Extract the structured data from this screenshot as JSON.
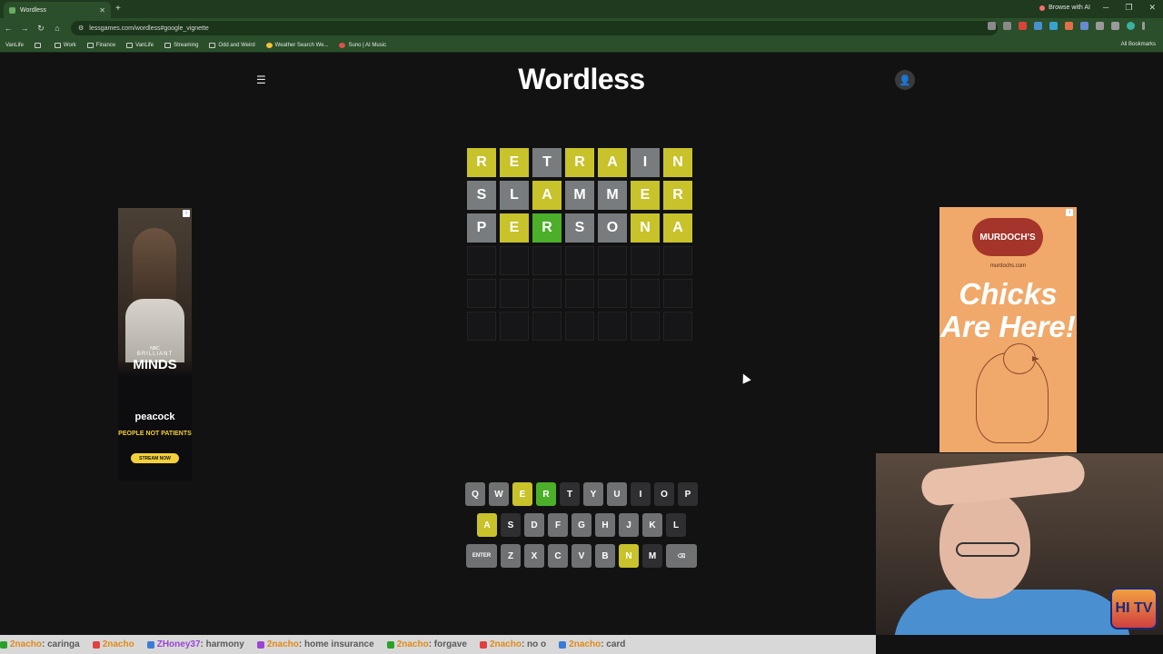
{
  "browser": {
    "tab_title": "Wordless",
    "new_tab": "+",
    "browse_ai": "Browse with AI",
    "url": "lessgames.com/wordless#google_vignette",
    "bookmarks": [
      "VanLife",
      "Work",
      "Finance",
      "VanLife",
      "Streaming",
      "Odd and Weird",
      "Weather Search We...",
      "Suno | AI Music"
    ],
    "all_bookmarks": "All Bookmarks"
  },
  "game": {
    "title": "Wordless",
    "rows": [
      [
        {
          "l": "R",
          "s": "y"
        },
        {
          "l": "E",
          "s": "y"
        },
        {
          "l": "T",
          "s": "x"
        },
        {
          "l": "R",
          "s": "y"
        },
        {
          "l": "A",
          "s": "y"
        },
        {
          "l": "I",
          "s": "x"
        },
        {
          "l": "N",
          "s": "y"
        }
      ],
      [
        {
          "l": "S",
          "s": "x"
        },
        {
          "l": "L",
          "s": "x"
        },
        {
          "l": "A",
          "s": "y"
        },
        {
          "l": "M",
          "s": "x"
        },
        {
          "l": "M",
          "s": "x"
        },
        {
          "l": "E",
          "s": "y"
        },
        {
          "l": "R",
          "s": "y"
        }
      ],
      [
        {
          "l": "P",
          "s": "x"
        },
        {
          "l": "E",
          "s": "y"
        },
        {
          "l": "R",
          "s": "g"
        },
        {
          "l": "S",
          "s": "x"
        },
        {
          "l": "O",
          "s": "x"
        },
        {
          "l": "N",
          "s": "y"
        },
        {
          "l": "A",
          "s": "y"
        }
      ],
      [
        {
          "l": "",
          "s": "e"
        },
        {
          "l": "",
          "s": "e"
        },
        {
          "l": "",
          "s": "e"
        },
        {
          "l": "",
          "s": "e"
        },
        {
          "l": "",
          "s": "e"
        },
        {
          "l": "",
          "s": "e"
        },
        {
          "l": "",
          "s": "e"
        }
      ],
      [
        {
          "l": "",
          "s": "e"
        },
        {
          "l": "",
          "s": "e"
        },
        {
          "l": "",
          "s": "e"
        },
        {
          "l": "",
          "s": "e"
        },
        {
          "l": "",
          "s": "e"
        },
        {
          "l": "",
          "s": "e"
        },
        {
          "l": "",
          "s": "e"
        }
      ],
      [
        {
          "l": "",
          "s": "e"
        },
        {
          "l": "",
          "s": "e"
        },
        {
          "l": "",
          "s": "e"
        },
        {
          "l": "",
          "s": "e"
        },
        {
          "l": "",
          "s": "e"
        },
        {
          "l": "",
          "s": "e"
        },
        {
          "l": "",
          "s": "e"
        }
      ]
    ],
    "keyboard": [
      [
        {
          "k": "Q",
          "s": ""
        },
        {
          "k": "W",
          "s": ""
        },
        {
          "k": "E",
          "s": "y"
        },
        {
          "k": "R",
          "s": "g"
        },
        {
          "k": "T",
          "s": "dark"
        },
        {
          "k": "Y",
          "s": ""
        },
        {
          "k": "U",
          "s": ""
        },
        {
          "k": "I",
          "s": "dark"
        },
        {
          "k": "O",
          "s": "dark"
        },
        {
          "k": "P",
          "s": "dark"
        }
      ],
      [
        {
          "k": "A",
          "s": "y"
        },
        {
          "k": "S",
          "s": "dark"
        },
        {
          "k": "D",
          "s": ""
        },
        {
          "k": "F",
          "s": ""
        },
        {
          "k": "G",
          "s": ""
        },
        {
          "k": "H",
          "s": ""
        },
        {
          "k": "J",
          "s": ""
        },
        {
          "k": "K",
          "s": ""
        },
        {
          "k": "L",
          "s": "dark"
        }
      ],
      [
        {
          "k": "ENTER",
          "s": "wide"
        },
        {
          "k": "Z",
          "s": ""
        },
        {
          "k": "X",
          "s": ""
        },
        {
          "k": "C",
          "s": ""
        },
        {
          "k": "V",
          "s": ""
        },
        {
          "k": "B",
          "s": ""
        },
        {
          "k": "N",
          "s": "y"
        },
        {
          "k": "M",
          "s": "dark"
        },
        {
          "k": "⌫",
          "s": "wide"
        }
      ]
    ],
    "colors": {
      "yellow": "#c8c22b",
      "green": "#4caf2a",
      "gray": "#787c7e"
    }
  },
  "ads": {
    "left": {
      "brand": "NBC",
      "line1": "BRILLIANT",
      "line2": "MINDS",
      "network": "peacock",
      "tagline": "PEOPLE NOT PATIENTS",
      "cta": "STREAM NOW"
    },
    "right": {
      "logo": "MURDOCH'S",
      "site": "murdochs.com",
      "headline": "Chicks Are Here!"
    }
  },
  "webcam": {
    "logo": "HI TV"
  },
  "ticker": [
    {
      "user": "2nacho",
      "msg": ": caringa"
    },
    {
      "user": "2nacho",
      "msg": ""
    },
    {
      "user": "ZHoney37",
      "msg": ": harmony",
      "purple": true
    },
    {
      "user": "2nacho",
      "msg": ": home insurance"
    },
    {
      "user": "2nacho",
      "msg": ": forgave"
    },
    {
      "user": "2nacho",
      "msg": ": no o"
    },
    {
      "user": "2nacho",
      "msg": ": card"
    }
  ]
}
